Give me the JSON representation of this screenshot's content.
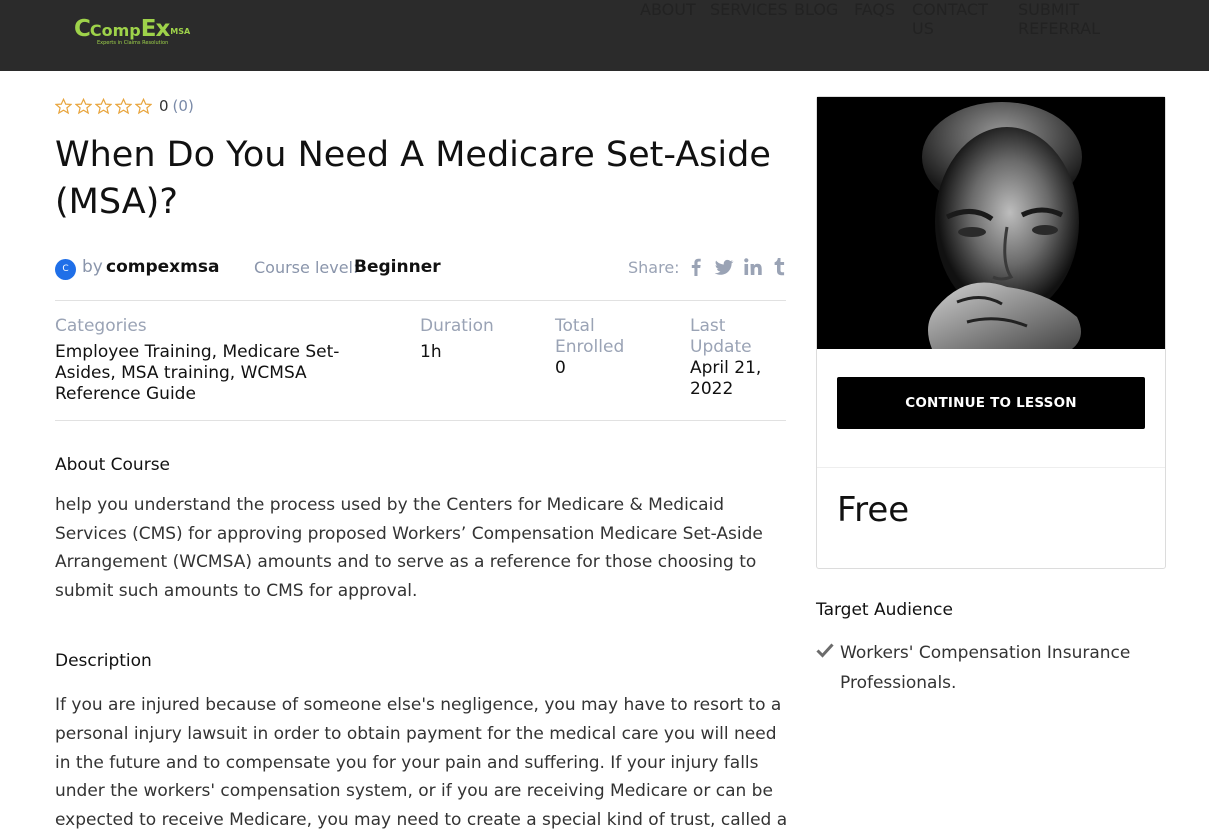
{
  "brand": {
    "logo_text_part1": "Comp",
    "logo_text_part2": "Ex",
    "logo_suffix": "MSA",
    "tagline": "Experts in Claims Resolution",
    "accent_color": "#9ed24a",
    "header_bg": "#2b2b2b"
  },
  "nav": {
    "items": [
      {
        "label": "ABOUT",
        "icon": "document-list-icon"
      },
      {
        "label": "SERVICES",
        "icon": "users-icon"
      },
      {
        "label": "BLOG",
        "icon": "text-lines-icon"
      },
      {
        "label": "FAQS",
        "icon": "question-circle-icon"
      },
      {
        "label": "CONTACT US",
        "icon": "envelope-icon"
      },
      {
        "label": "SUBMIT REFERRAL",
        "icon": "door-enter-icon"
      }
    ]
  },
  "course": {
    "rating_value": "0",
    "rating_count": "(0)",
    "rating_stars_filled": 0,
    "rating_stars_total": 5,
    "title": "When Do You Need A Medicare Set-Aside (MSA)?",
    "author_initial": "C",
    "by_label": "by",
    "author": "compexmsa",
    "level_label": "Course level:",
    "level_value": "Beginner",
    "share_label": "Share:",
    "share_icons": [
      "facebook-icon",
      "twitter-icon",
      "linkedin-icon",
      "tumblr-icon"
    ],
    "info": {
      "categories_label": "Categories",
      "categories_value": "Employee Training, Medicare Set-Asides, MSA training, WCMSA Reference Guide",
      "duration_label": "Duration",
      "duration_value": "1h",
      "enrolled_label": "Total Enrolled",
      "enrolled_value": "0",
      "update_label": "Last Update",
      "update_value": "April 21, 2022"
    },
    "about_heading": "About Course",
    "about_text": "help you understand the process used by the Centers for Medicare & Medicaid Services (CMS) for approving proposed Workers’ Compensation Medicare Set-Aside Arrangement (WCMSA) amounts and to serve as a reference for those choosing to submit such amounts to CMS for approval.",
    "description_heading": "Description",
    "description_text": "If you are injured because of someone else's negligence, you may have to resort to a personal injury lawsuit in order to obtain payment for the medical care you will need in the future and to compensate you for your pain and suffering. If your injury falls under the workers' compensation system, or if you are receiving Medicare or can be expected to receive Medicare, you may need to create a special kind of trust, called a Medicare"
  },
  "sidebar": {
    "button_label": "CONTINUE TO LESSON",
    "price": "Free",
    "target_heading": "Target Audience",
    "target_items": [
      "Workers' Compensation Insurance Professionals."
    ]
  }
}
